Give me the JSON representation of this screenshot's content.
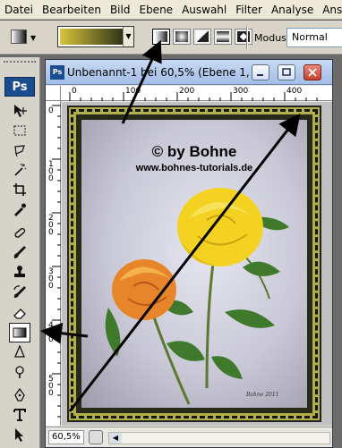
{
  "menu": [
    "Datei",
    "Bearbeiten",
    "Bild",
    "Ebene",
    "Auswahl",
    "Filter",
    "Analyse",
    "Ansic"
  ],
  "options": {
    "modus_label": "Modus:",
    "modus_value": "Normal",
    "gradient_types": [
      "linear",
      "radial",
      "angle",
      "reflected",
      "diamond"
    ],
    "active_gradient_type": "linear",
    "gradient_colors": [
      "#d8c43a",
      "#2f3616"
    ]
  },
  "toolbox": {
    "logo": "Ps",
    "tools": [
      "move-icon",
      "marquee-icon",
      "lasso-icon",
      "magic-wand-icon",
      "crop-icon",
      "eyedropper-icon",
      "healing-icon",
      "brush-icon",
      "stamp-icon",
      "history-brush-icon",
      "eraser-icon",
      "gradient-icon",
      "blur-icon",
      "dodge-icon",
      "pen-icon",
      "type-icon",
      "path-select-icon"
    ],
    "active_tool": "gradient-icon"
  },
  "document": {
    "icon_label": "Ps",
    "title": "Unbenannt-1 bei 60,5% (Ebene 1, R...",
    "ruler_h": [
      "0",
      "100",
      "200",
      "300",
      "400"
    ],
    "ruler_v": [
      "0",
      "100",
      "200",
      "300",
      "400",
      "500"
    ],
    "zoom": "60,5%"
  },
  "canvas": {
    "watermark_line1": "© by Bohne",
    "watermark_line2": "www.bohnes-tutorials.de",
    "signature": "Bohne 2011"
  },
  "colors": {
    "frame_gold": "#b2b04a",
    "frame_dark": "#27291a",
    "rose_yellow": "#f3d222",
    "rose_orange": "#e8852a",
    "leaf_green": "#3f7a2c"
  }
}
